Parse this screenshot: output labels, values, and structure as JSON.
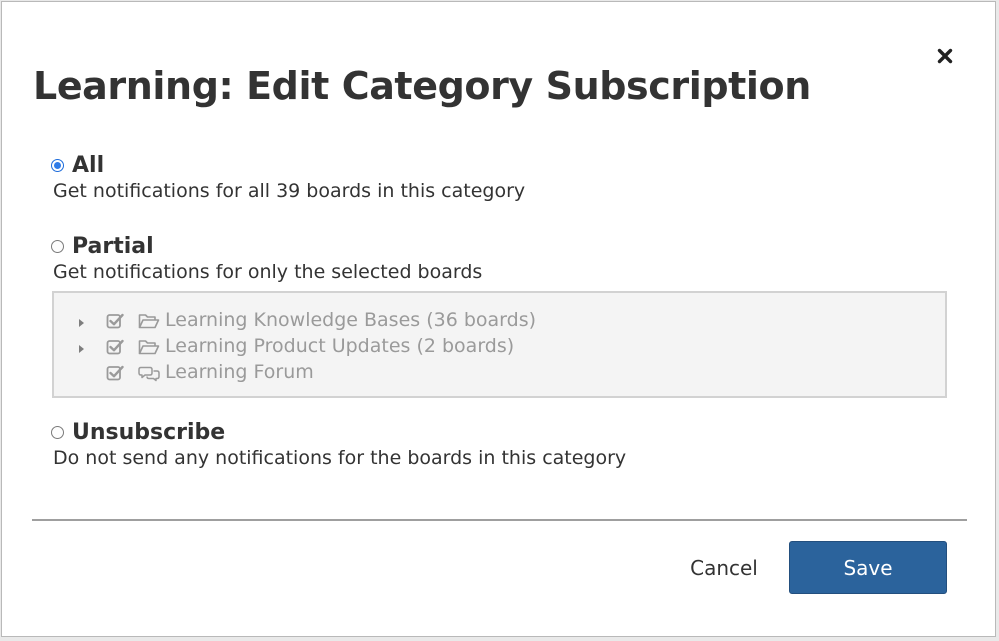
{
  "modal": {
    "title": "Learning: Edit Category Subscription",
    "close_icon": "close-icon"
  },
  "options": {
    "all": {
      "label": "All",
      "description": "Get notifications for all 39 boards in this category",
      "selected": true
    },
    "partial": {
      "label": "Partial",
      "description": "Get notifications for only the selected boards",
      "selected": false
    },
    "unsubscribe": {
      "label": "Unsubscribe",
      "description": "Do not send any notifications for the boards in this category",
      "selected": false
    }
  },
  "boards": [
    {
      "label": "Learning Knowledge Bases (36 boards)",
      "icon": "folder-icon",
      "checked": true,
      "expandable": true
    },
    {
      "label": "Learning Product Updates (2 boards)",
      "icon": "folder-icon",
      "checked": true,
      "expandable": true
    },
    {
      "label": "Learning Forum",
      "icon": "forum-icon",
      "checked": true,
      "expandable": false
    }
  ],
  "footer": {
    "cancel_label": "Cancel",
    "save_label": "Save"
  },
  "colors": {
    "primary_button": "#2b639c",
    "radio_selected": "#2f7ce8",
    "text": "#333333",
    "disabled_text": "#9a9a9a"
  }
}
